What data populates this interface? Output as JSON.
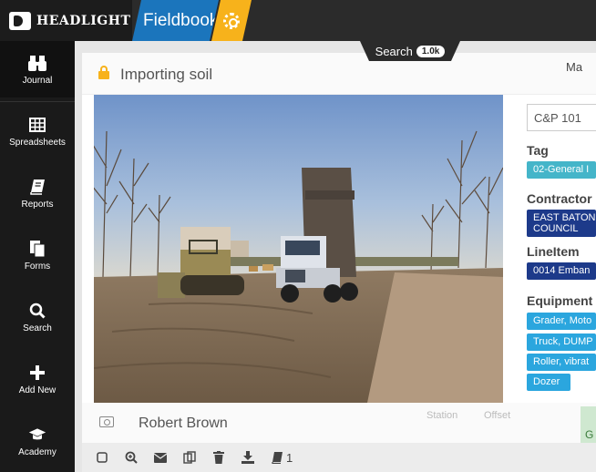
{
  "app": {
    "brand": "HEADLIGHT",
    "product": "Fieldbook"
  },
  "search_tab": {
    "label": "Search",
    "count": "1.0k"
  },
  "sidebar": {
    "items": [
      {
        "label": "Journal",
        "icon": "binoculars-icon"
      },
      {
        "label": "Spreadsheets",
        "icon": "grid-icon"
      },
      {
        "label": "Reports",
        "icon": "book-icon"
      },
      {
        "label": "Forms",
        "icon": "forms-icon"
      },
      {
        "label": "Search",
        "icon": "search-icon"
      },
      {
        "label": "Add New",
        "icon": "plus-icon"
      },
      {
        "label": "Academy",
        "icon": "graduation-cap-icon"
      }
    ]
  },
  "entry": {
    "title": "Importing soil",
    "map_label": "Ma",
    "project": "C&P 101",
    "tag_label": "Tag",
    "tag": "02-General I",
    "contractor_label": "Contractor",
    "contractor": "EAST BATON COUNCIL",
    "lineitem_label": "LineItem",
    "lineitem": "0014 Emban",
    "equipment_label": "Equipment",
    "equipment": [
      "Grader, Moto",
      "Truck, DUMP",
      "Roller, vibrat",
      "Dozer"
    ],
    "author": "Robert Brown",
    "station_label": "Station",
    "offset_label": "Offset",
    "map_letter": "G",
    "attachment_count": "1"
  },
  "colors": {
    "accent_blue": "#1b75bc",
    "accent_yellow": "#f7b21b",
    "chip_cyan": "#2ba6de",
    "chip_navy": "#1d3a8a"
  }
}
